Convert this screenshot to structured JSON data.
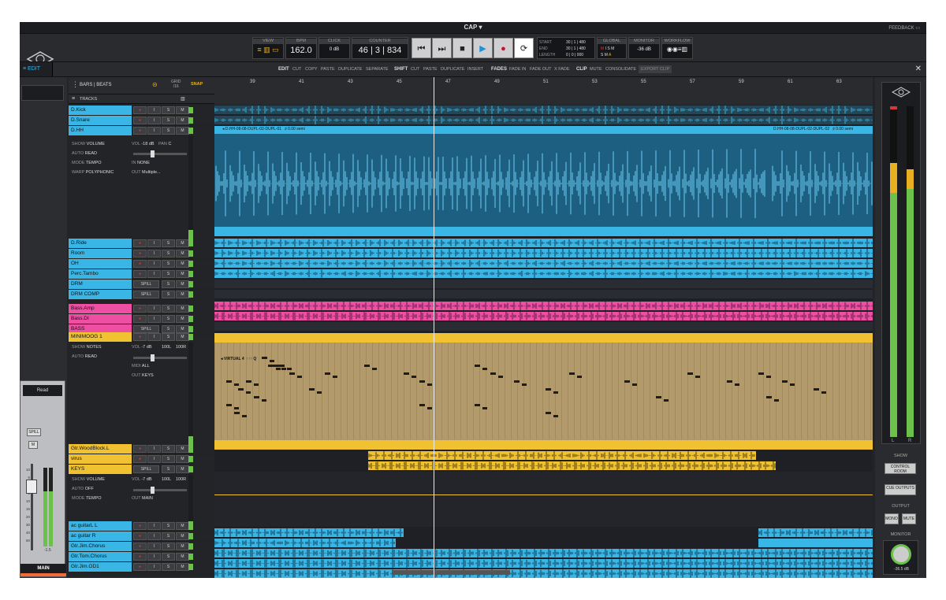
{
  "window": {
    "title": "CAP",
    "feedback": "FEEDBACK"
  },
  "transport": {
    "view_label": "VIEW",
    "bpm_label": "BPM",
    "bpm": "162.0",
    "click_label": "CLICK",
    "click_value": "0 dB",
    "counter_label": "COUNTER",
    "counter": "46 | 3 | 834",
    "start_label": "START",
    "end_label": "END",
    "length_label": "LENGTH",
    "start": "30 | 1 | 480",
    "end": "30 | 1 | 480",
    "length": "0 | 0 | 000",
    "global_label": "GLOBAL",
    "global_values": [
      "M",
      "I",
      "S",
      "M",
      "S",
      "M",
      "A"
    ],
    "monitor_label": "MONITOR",
    "monitor_value": "-36 dB",
    "workflow_label": "WORKFLOW"
  },
  "editbar": {
    "edit_tab": "EDIT",
    "edit": "EDIT",
    "cut": "CUT",
    "copy": "COPY",
    "paste": "PASTE",
    "duplicate": "DUPLICATE",
    "separate": "SEPARATE",
    "shift": "SHIFT",
    "shift_cut": "CUT",
    "shift_paste": "PASTE",
    "shift_duplicate": "DUPLICATE",
    "insert": "INSERT",
    "fades": "FADES",
    "fade_in": "FADE IN",
    "fade_out": "FADE OUT",
    "x_fade": "X FADE",
    "clip": "CLIP",
    "mute": "MUTE",
    "consolidate": "CONSOLIDATE",
    "export_clip": "EXPORT CLIP"
  },
  "tracklist_header": {
    "bars_beats": "BARS | BEATS",
    "grid_label": "GRID",
    "grid_value": "/16",
    "snap": "SNAP",
    "tracks": "TRACKS"
  },
  "ruler": {
    "marks": [
      "39",
      "41",
      "43",
      "45",
      "47",
      "49",
      "51",
      "53",
      "55",
      "57",
      "59",
      "61",
      "63"
    ]
  },
  "track_buttons": {
    "rec": "●",
    "input": "I",
    "solo": "S",
    "mute": "M",
    "spill": "SPILL"
  },
  "tracks": [
    {
      "name": "D.Kick",
      "color": "#3ab6e6"
    },
    {
      "name": "D.Snare",
      "color": "#3ab6e6"
    },
    {
      "name": "D.HH",
      "color": "#3ab6e6"
    },
    {
      "name": "D.Ride",
      "color": "#3ab6e6"
    },
    {
      "name": "Room",
      "color": "#3ab6e6"
    },
    {
      "name": "OH",
      "color": "#3ab6e6"
    },
    {
      "name": "Perc.Tambo",
      "color": "#3ab6e6"
    },
    {
      "name": "DRM",
      "color": "#3ab6e6"
    },
    {
      "name": "DRM COMP",
      "color": "#3ab6e6"
    },
    {
      "name": "Bass.Amp",
      "color": "#ee4fa3"
    },
    {
      "name": "Bass.DI",
      "color": "#ee4fa3"
    },
    {
      "name": "BASS",
      "color": "#ee4fa3"
    },
    {
      "name": "MINIMOOG 1",
      "color": "#f0c130"
    },
    {
      "name": "Gtr.WoodBlock.L",
      "color": "#f0c130"
    },
    {
      "name": "virus",
      "color": "#f0c130"
    },
    {
      "name": "KEYS",
      "color": "#f0c130"
    },
    {
      "name": "ac guitarL L",
      "color": "#3ab6e6"
    },
    {
      "name": "ac guitar R",
      "color": "#3ab6e6"
    },
    {
      "name": "Gtr.Jim.Chorus",
      "color": "#3ab6e6"
    },
    {
      "name": "Gtr.Tom.Chorus",
      "color": "#3ab6e6"
    },
    {
      "name": "Gtr.Jim.OD1",
      "color": "#3ab6e6"
    }
  ],
  "hh_params": {
    "show": "SHOW",
    "show_v": "VOLUME",
    "vol": "VOL",
    "vol_v": "-18 dB",
    "pan": "PAN",
    "pan_v": "C",
    "auto": "AUTO",
    "auto_v": "READ",
    "mode": "MODE",
    "mode_v": "TEMPO",
    "in": "IN",
    "in_v": "NONE",
    "warp": "WARP",
    "warp_v": "POLYPHONIC",
    "out": "OUT",
    "out_v": "Multiple..."
  },
  "moog_params": {
    "show": "SHOW",
    "show_v": "NOTES",
    "vol": "VOL",
    "vol_v": "-7 dB",
    "l": "100L",
    "r": "100R",
    "auto": "AUTO",
    "auto_v": "READ",
    "midi": "MIDI",
    "midi_v": "ALL",
    "out": "OUT",
    "out_v": "KEYS"
  },
  "keys_params": {
    "show": "SHOW",
    "show_v": "VOLUME",
    "vol": "VOL",
    "vol_v": "-7 dB",
    "l": "100L",
    "r": "100R",
    "auto": "AUTO",
    "auto_v": "OFF",
    "mode": "MODE",
    "mode_v": "TEMPO",
    "out": "OUT",
    "out_v": "MAIN"
  },
  "clips": {
    "hh_clip_1": "D.HH-08-08-DUPL-02-DUPL-01",
    "hh_clip_2": "D.HH-08-08-DUPL-02-DUPL-02",
    "semi_1": "0.00 semi",
    "semi_2": "0.00 semi",
    "virtual": "VIRTUAL 4"
  },
  "fader": {
    "read": "Read",
    "spill": "SPILL",
    "m": "M",
    "readout": "-1.5",
    "main": "MAIN",
    "scale": [
      "10",
      "5",
      "0",
      "5",
      "10",
      "15",
      "20",
      "30",
      "40",
      "60"
    ]
  },
  "meters": {
    "l": "L",
    "r": "R",
    "show_label": "SHOW",
    "control_room": "CONTROL ROOM",
    "cue_outputs": "CUE OUTPUTS",
    "output_label": "OUTPUT",
    "mono": "MONO",
    "mute": "MUTE",
    "monitor_label": "MONITOR",
    "monitor_readout": "-36.5 dB"
  },
  "colors": {
    "blue": "#3ab6e6",
    "pink": "#ee4fa3",
    "yellow": "#f0c130",
    "play": "#1e90d4",
    "rec": "#c8102e"
  }
}
